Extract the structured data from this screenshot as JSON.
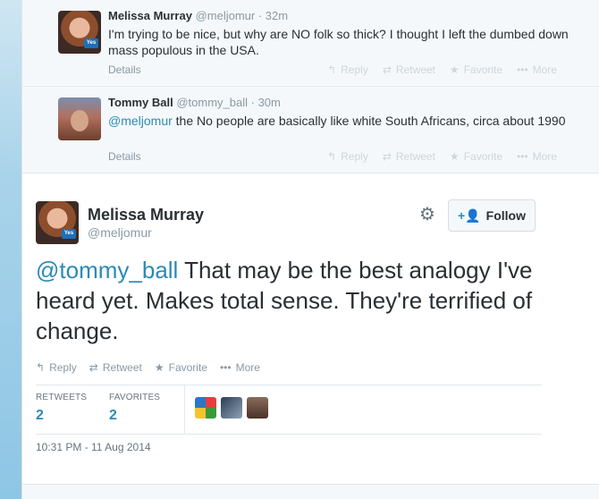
{
  "context_tweets": [
    {
      "name": "Melissa Murray",
      "handle": "@meljomur",
      "time": "· 32m",
      "mention": "",
      "text": "I'm trying to be nice, but why are NO folk so thick? I thought I left the dumbed down mass populous in the USA.",
      "details": "Details"
    },
    {
      "name": "Tommy Ball",
      "handle": "@tommy_ball",
      "time": "· 30m",
      "mention": "@meljomur",
      "text": " the No people are basically like white South Africans, circa about 1990",
      "details": "Details"
    }
  ],
  "actions": {
    "reply": "Reply",
    "retweet": "Retweet",
    "favorite": "Favorite",
    "more": "More"
  },
  "main_tweet": {
    "name": "Melissa Murray",
    "handle": "@meljomur",
    "follow_label": "Follow",
    "mention": "@tommy_ball",
    "text": " That may be the best analogy I've heard yet. Makes total sense. They're terrified of change.",
    "stats": {
      "retweets_label": "RETWEETS",
      "retweets_value": "2",
      "favorites_label": "FAVORITES",
      "favorites_value": "2"
    },
    "timestamp": "10:31 PM - 11 Aug 2014"
  },
  "avatar_badge": "Yes",
  "colors": {
    "link": "#2a8ab8",
    "text": "#292f33",
    "muted": "#8899a6"
  }
}
